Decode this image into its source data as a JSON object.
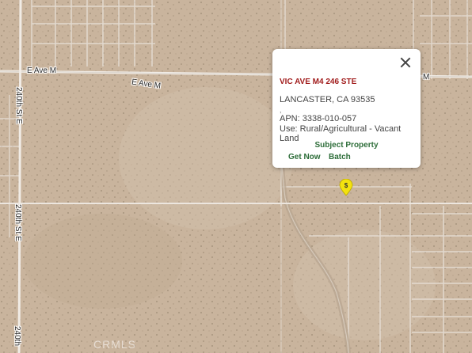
{
  "map": {
    "roads": {
      "e_ave_m_west": "E Ave M",
      "e_ave_m_center": "E Ave M",
      "street_240th_upper": "240th St E",
      "street_240th_lower": "240th St E",
      "street_240th_bottom": "240th",
      "e_ave_m_right": "M"
    },
    "marker_glyph": "$",
    "watermark": "CRMLS",
    "colors": {
      "terrain": "#c9b49d",
      "road": "#e9e4df",
      "marker": "#f3e20f",
      "title": "#a11d1d",
      "link": "#2e6e3a"
    }
  },
  "popup": {
    "address": "VIC AVE M4 246 STE",
    "city_line": "LANCASTER, CA 93535",
    "separator": ",",
    "apn": "APN: 3338-010-057",
    "use": "Use: Rural/Agricultural - Vacant Land",
    "subject_label": "Subject Property",
    "get_now_label": "Get Now",
    "batch_label": "Batch",
    "close_icon": "close-icon"
  }
}
